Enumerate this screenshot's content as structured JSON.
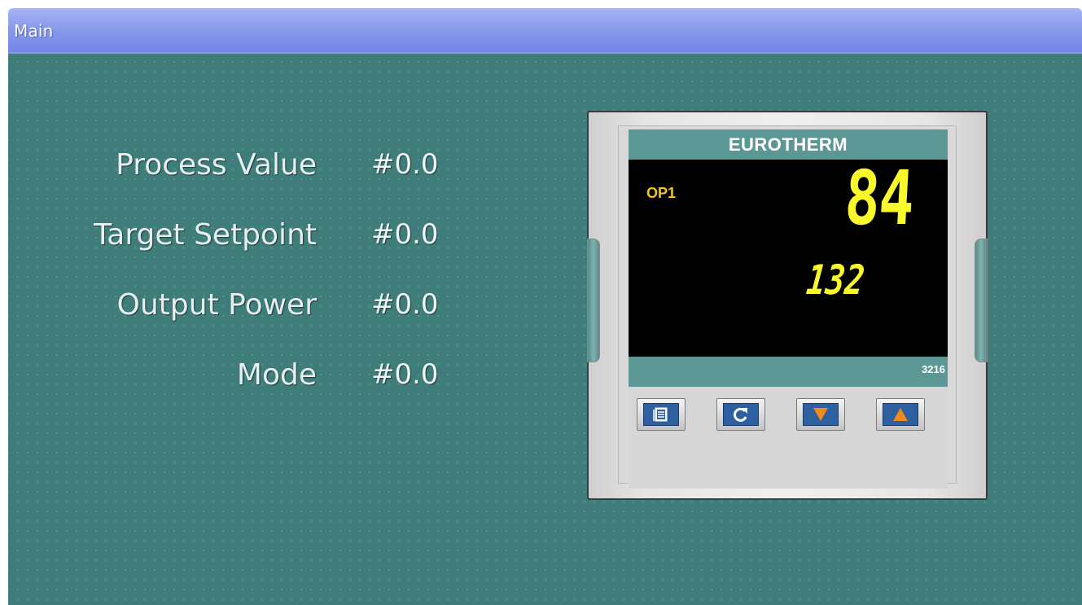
{
  "window": {
    "title": "Main"
  },
  "fields": [
    {
      "label": "Process Value",
      "value": "#0.0"
    },
    {
      "label": "Target Setpoint",
      "value": "#0.0"
    },
    {
      "label": "Output Power",
      "value": "#0.0"
    },
    {
      "label": "Mode",
      "value": "#0.0"
    }
  ],
  "controller": {
    "brand": "EUROTHERM",
    "output_indicator": "OP1",
    "main_reading": "84",
    "secondary_reading": "132",
    "model": "3216",
    "keys": [
      {
        "icon": "page-icon"
      },
      {
        "icon": "scroll-icon"
      },
      {
        "icon": "down-arrow-icon"
      },
      {
        "icon": "up-arrow-icon"
      }
    ]
  },
  "colors": {
    "background": "#3f7d7b",
    "accent_bar": "#5b9794",
    "display_digits": "#f8f82a",
    "op_indicator": "#f3c81a",
    "key_face": "#2e5fa0",
    "key_arrow": "#f08a1c"
  }
}
